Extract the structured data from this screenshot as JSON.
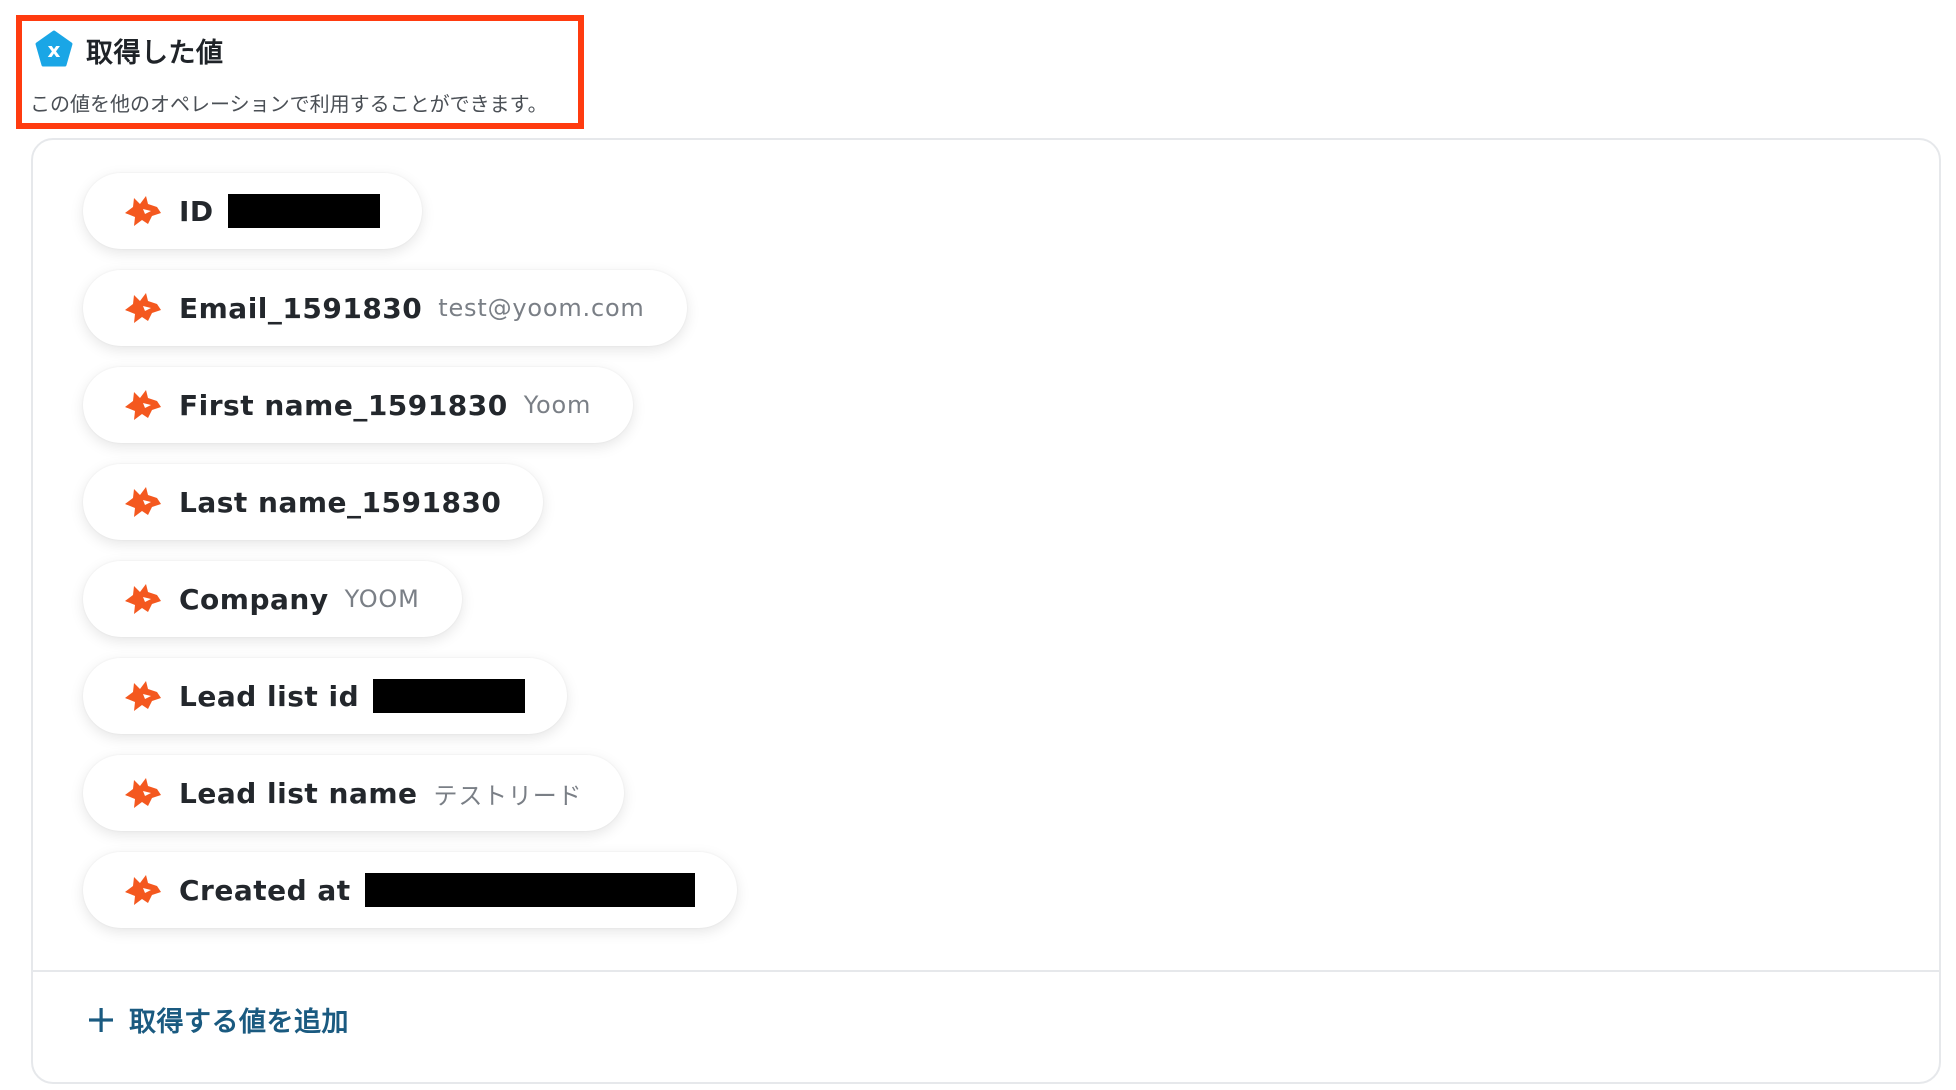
{
  "header": {
    "title": "取得した値",
    "subtitle": "この値を他のオペレーションで利用することができます。",
    "badge_icon": "x-variable-icon",
    "highlight_color": "#ff3b0f"
  },
  "fields": [
    {
      "name": "ID",
      "value": "",
      "redacted": true
    },
    {
      "name": "Email_1591830",
      "value": "test@yoom.com",
      "redacted": false
    },
    {
      "name": "First name_1591830",
      "value": "Yoom",
      "redacted": false
    },
    {
      "name": "Last name_1591830",
      "value": "",
      "redacted": false
    },
    {
      "name": "Company",
      "value": "YOOM",
      "redacted": false
    },
    {
      "name": "Lead list id",
      "value": "",
      "redacted": true
    },
    {
      "name": "Lead list name",
      "value": "テストリード",
      "redacted": false
    },
    {
      "name": "Created at",
      "value": "",
      "redacted": true
    }
  ],
  "field_icon": "fox-logo-icon",
  "add_button": {
    "label": "取得する値を追加",
    "icon": "plus-icon"
  },
  "colors": {
    "fox_orange": "#f4581f",
    "badge_blue": "#1aa6e6",
    "add_text": "#1a5a80"
  }
}
